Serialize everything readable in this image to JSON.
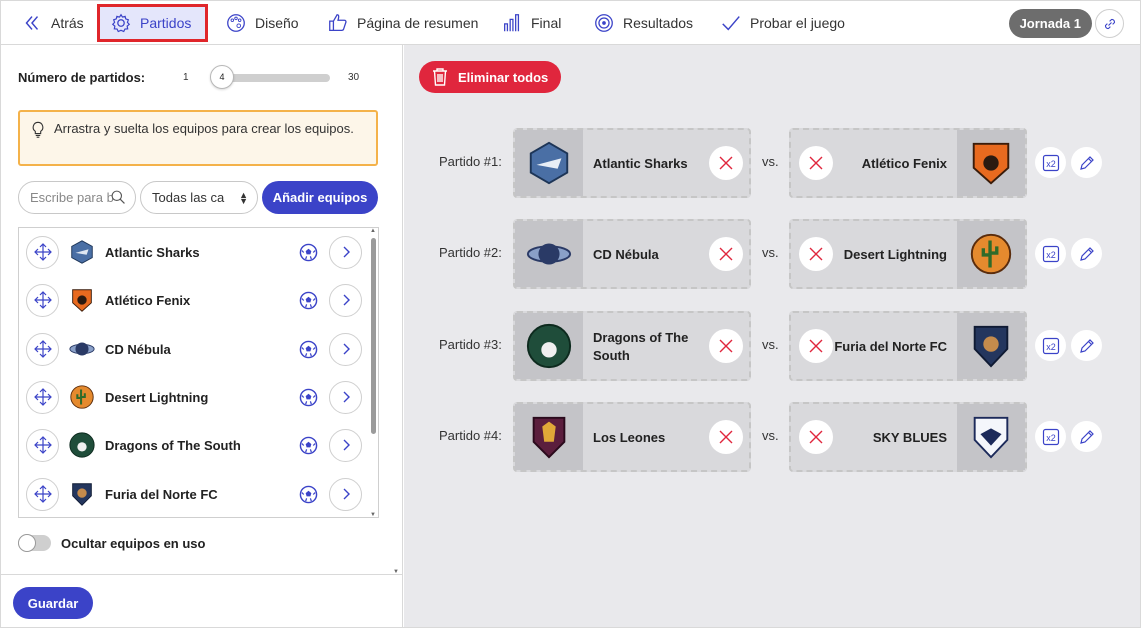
{
  "nav": {
    "back_label": "Atrás",
    "tabs": [
      {
        "label": "Partidos",
        "icon": "gear-icon",
        "active": true
      },
      {
        "label": "Diseño",
        "icon": "palette-icon"
      },
      {
        "label": "Página de resumen",
        "icon": "thumbs-up-icon"
      },
      {
        "label": "Final",
        "icon": "bar-chart-icon"
      },
      {
        "label": "Resultados",
        "icon": "target-icon"
      },
      {
        "label": "Probar el juego",
        "icon": "check-icon"
      }
    ],
    "round_label": "Jornada 1"
  },
  "left": {
    "matches_label": "Número de partidos:",
    "slider_min": "1",
    "slider_max": "30",
    "slider_value": "4",
    "hint_text": "Arrastra y suelta los equipos para crear los equipos.",
    "search_placeholder": "Escribe para b",
    "category_select": "Todas las ca",
    "add_teams_label": "Añadir equipos",
    "teams": [
      {
        "name": "Atlantic Sharks"
      },
      {
        "name": "Atlético Fenix"
      },
      {
        "name": "CD Nébula"
      },
      {
        "name": "Desert Lightning"
      },
      {
        "name": "Dragons of The South"
      },
      {
        "name": "Furia del Norte FC"
      }
    ],
    "hide_used_label": "Ocultar equipos en uso",
    "save_label": "Guardar"
  },
  "right": {
    "delete_all_label": "Eliminar todos",
    "vs_label": "vs.",
    "matches": [
      {
        "label": "Partido #1:",
        "home": "Atlantic Sharks",
        "away": "Atlético Fenix"
      },
      {
        "label": "Partido #2:",
        "home": "CD Nébula",
        "away": "Desert Lightning"
      },
      {
        "label": "Partido #3:",
        "home": "Dragons of The South",
        "away": "Furia del Norte FC"
      },
      {
        "label": "Partido #4:",
        "home": "Los Leones",
        "away": "SKY BLUES"
      }
    ],
    "double_label": "x2"
  },
  "colors": {
    "accent": "#3b43c8",
    "danger": "#e0263d",
    "highlight_border": "#e0262b",
    "hint_border": "#f4b24a"
  }
}
